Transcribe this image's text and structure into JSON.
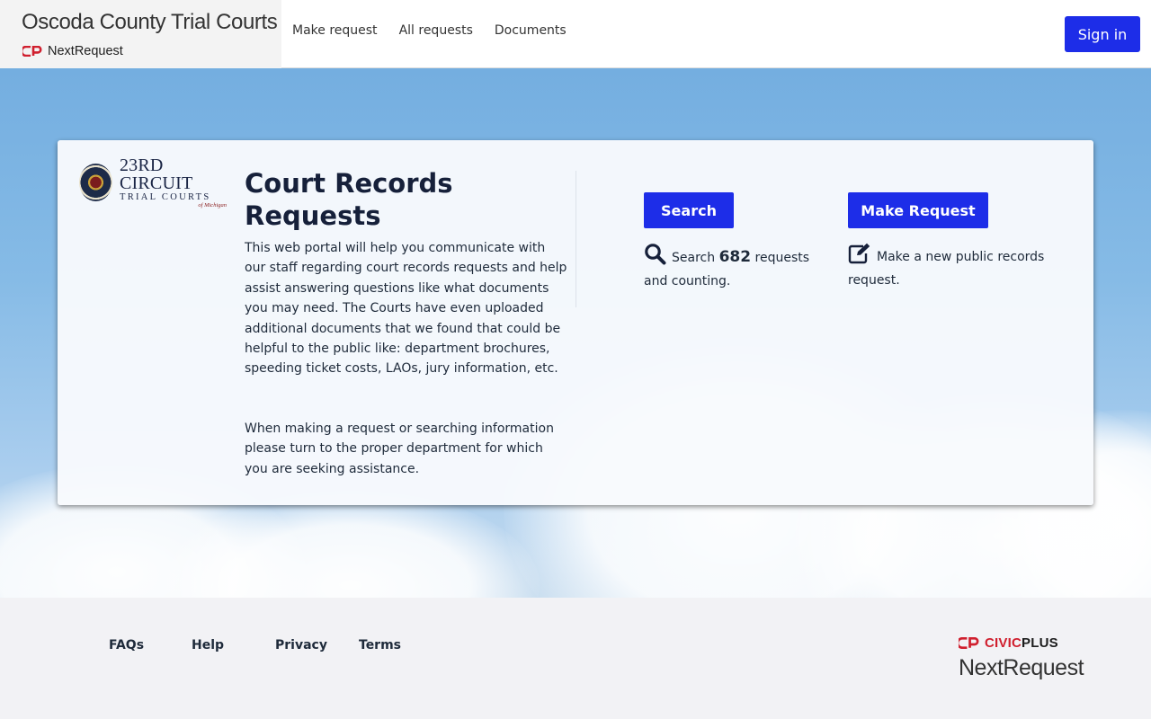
{
  "header": {
    "site_title": "Oscoda County Trial Courts",
    "brand_name": "NextRequest",
    "nav": [
      {
        "label": "Make request"
      },
      {
        "label": "All requests"
      },
      {
        "label": "Documents"
      }
    ],
    "sign_in_label": "Sign in"
  },
  "card": {
    "logo": {
      "line1": "23RD CIRCUIT",
      "line2": "TRIAL COURTS",
      "line3": "of Michigan"
    },
    "title": "Court Records Requests",
    "description": "This web portal will help you communicate with our staff regarding court records requests and help assist answering questions like what documents you may need. The Courts have even uploaded additional documents that we found that could be helpful to the public like: department brochures, speeding ticket costs, LAOs, jury information, etc.",
    "description2": "When making a request or searching information please turn to the proper department for which you are seeking assistance.",
    "search": {
      "button_label": "Search",
      "text_prefix": "Search",
      "count": "682",
      "text_suffix": "requests and counting.",
      "icon": "search-icon"
    },
    "make_request": {
      "button_label": "Make Request",
      "text": "Make a new public records request.",
      "icon": "edit-icon"
    }
  },
  "footer": {
    "links": [
      {
        "label": "FAQs"
      },
      {
        "label": "Help"
      },
      {
        "label": "Privacy"
      },
      {
        "label": "Terms"
      }
    ],
    "civic_label": "CIVIC",
    "plus_label": "PLUS",
    "product_label": "NextRequest"
  },
  "colors": {
    "primary_button": "#1d2de8",
    "civicplus_red": "#d01f2e",
    "sky": "#86bbe6"
  }
}
